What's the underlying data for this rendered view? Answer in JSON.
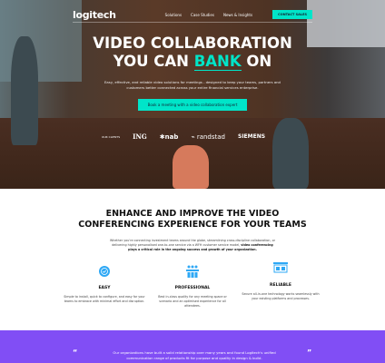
{
  "nav": {
    "logo": "logitech",
    "links": [
      "Solutions",
      "Case Studies",
      "News & Insights"
    ],
    "contact": "CONTACT SALES"
  },
  "hero": {
    "title_line1": "VIDEO COLLABORATION",
    "title_pre": "YOU CAN ",
    "title_accent": "BANK",
    "title_post": " ON",
    "subtitle": "Easy, effective, and reliable video solutions for meetings - designed to keep your teams, partners and customers better connected across your entire financial services enterprise.",
    "cta": "Book a meeting with a video collaboration expert",
    "clients_label": "OUR CLIENTS",
    "clients": [
      "ING",
      "nab",
      "randstad",
      "SIEMENS"
    ]
  },
  "intro": {
    "title": "ENHANCE AND IMPROVE THE VIDEO CONFERENCING EXPERIENCE FOR YOUR TEAMS",
    "text": "Whether you're connecting investment teams around the globe, streamlining cross-discipline collaboration, or delivering highly personalised one-to-one service via a WFH customer service model, ",
    "bold": "video conferencing plays a critical role in the ongoing success and growth of your organization."
  },
  "features": [
    {
      "icon": "gear-check-icon",
      "title": "EASY",
      "text": "Simple to install, quick to configure, and easy for your teams to embrace with minimal effort and disruption."
    },
    {
      "icon": "team-icon",
      "title": "PROFESSIONAL",
      "text": "Best in-class quality for any meeting space or scenario and an optimised experience for all attendees."
    },
    {
      "icon": "monitor-icon",
      "title": "RELIABLE",
      "text": "Secure all-in-one technology works seamlessly with your existing platforms and processes."
    }
  ],
  "testimonial": {
    "open": "“",
    "close": "”",
    "text": "Our organizations have built a solid relationship over many years and found Logitech's unified communication range of products fit for purpose and quality in design & build."
  },
  "colors": {
    "accent": "#00e5c9",
    "purple": "#814ef5",
    "icon_blue": "#2ea8f5"
  }
}
